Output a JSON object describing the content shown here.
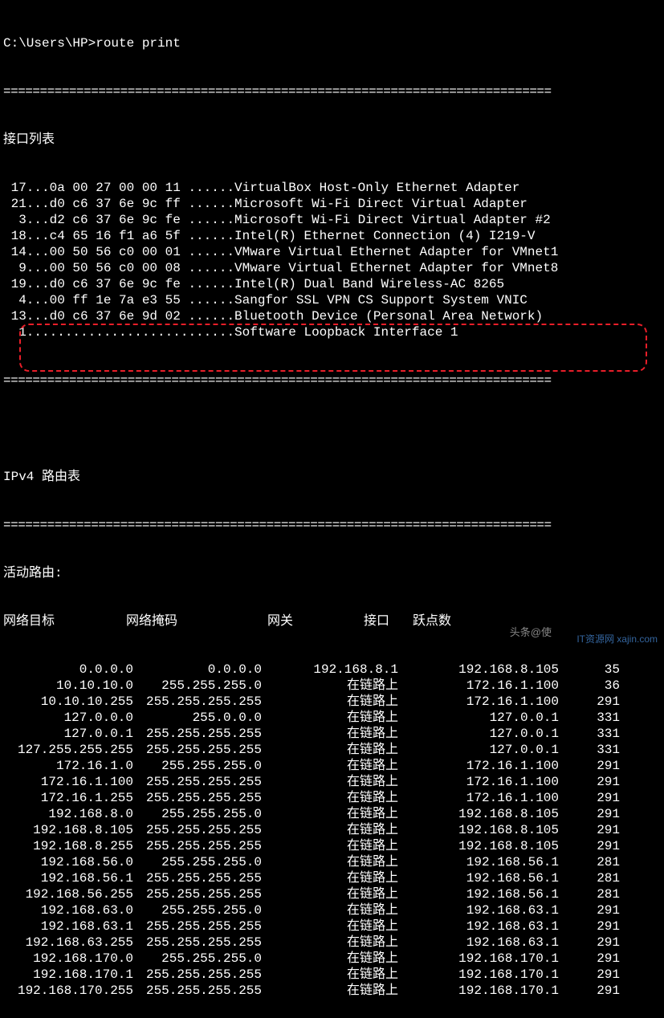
{
  "prompt": "C:\\Users\\HP>route print",
  "separator": "===========================================================================",
  "interfaces_header": "接口列表",
  "interfaces": [
    " 17...0a 00 27 00 00 11 ......VirtualBox Host-Only Ethernet Adapter",
    " 21...d0 c6 37 6e 9c ff ......Microsoft Wi-Fi Direct Virtual Adapter",
    "  3...d2 c6 37 6e 9c fe ......Microsoft Wi-Fi Direct Virtual Adapter #2",
    " 18...c4 65 16 f1 a6 5f ......Intel(R) Ethernet Connection (4) I219-V",
    " 14...00 50 56 c0 00 01 ......VMware Virtual Ethernet Adapter for VMnet1",
    "  9...00 50 56 c0 00 08 ......VMware Virtual Ethernet Adapter for VMnet8",
    " 19...d0 c6 37 6e 9c fe ......Intel(R) Dual Band Wireless-AC 8265",
    "  4...00 ff 1e 7a e3 55 ......Sangfor SSL VPN CS Support System VNIC",
    " 13...d0 c6 37 6e 9d 02 ......Bluetooth Device (Personal Area Network)",
    "  1...........................Software Loopback Interface 1"
  ],
  "ipv4_header": "IPv4 路由表",
  "active_routes_label": "活动路由:",
  "columns": {
    "dest": "网络目标",
    "mask": "网络掩码",
    "gw": "网关",
    "iface": "接口",
    "metric": "跃点数"
  },
  "routes": [
    {
      "dest": "0.0.0.0",
      "mask": "0.0.0.0",
      "gw": "192.168.8.1",
      "iface": "192.168.8.105",
      "metric": "35"
    },
    {
      "dest": "10.10.10.0",
      "mask": "255.255.255.0",
      "gw": "在链路上",
      "iface": "172.16.1.100",
      "metric": "36"
    },
    {
      "dest": "10.10.10.255",
      "mask": "255.255.255.255",
      "gw": "在链路上",
      "iface": "172.16.1.100",
      "metric": "291"
    },
    {
      "dest": "127.0.0.0",
      "mask": "255.0.0.0",
      "gw": "在链路上",
      "iface": "127.0.0.1",
      "metric": "331"
    },
    {
      "dest": "127.0.0.1",
      "mask": "255.255.255.255",
      "gw": "在链路上",
      "iface": "127.0.0.1",
      "metric": "331"
    },
    {
      "dest": "127.255.255.255",
      "mask": "255.255.255.255",
      "gw": "在链路上",
      "iface": "127.0.0.1",
      "metric": "331"
    },
    {
      "dest": "172.16.1.0",
      "mask": "255.255.255.0",
      "gw": "在链路上",
      "iface": "172.16.1.100",
      "metric": "291"
    },
    {
      "dest": "172.16.1.100",
      "mask": "255.255.255.255",
      "gw": "在链路上",
      "iface": "172.16.1.100",
      "metric": "291"
    },
    {
      "dest": "172.16.1.255",
      "mask": "255.255.255.255",
      "gw": "在链路上",
      "iface": "172.16.1.100",
      "metric": "291"
    },
    {
      "dest": "192.168.8.0",
      "mask": "255.255.255.0",
      "gw": "在链路上",
      "iface": "192.168.8.105",
      "metric": "291"
    },
    {
      "dest": "192.168.8.105",
      "mask": "255.255.255.255",
      "gw": "在链路上",
      "iface": "192.168.8.105",
      "metric": "291"
    },
    {
      "dest": "192.168.8.255",
      "mask": "255.255.255.255",
      "gw": "在链路上",
      "iface": "192.168.8.105",
      "metric": "291"
    },
    {
      "dest": "192.168.56.0",
      "mask": "255.255.255.0",
      "gw": "在链路上",
      "iface": "192.168.56.1",
      "metric": "281"
    },
    {
      "dest": "192.168.56.1",
      "mask": "255.255.255.255",
      "gw": "在链路上",
      "iface": "192.168.56.1",
      "metric": "281"
    },
    {
      "dest": "192.168.56.255",
      "mask": "255.255.255.255",
      "gw": "在链路上",
      "iface": "192.168.56.1",
      "metric": "281"
    },
    {
      "dest": "192.168.63.0",
      "mask": "255.255.255.0",
      "gw": "在链路上",
      "iface": "192.168.63.1",
      "metric": "291"
    },
    {
      "dest": "192.168.63.1",
      "mask": "255.255.255.255",
      "gw": "在链路上",
      "iface": "192.168.63.1",
      "metric": "291"
    },
    {
      "dest": "192.168.63.255",
      "mask": "255.255.255.255",
      "gw": "在链路上",
      "iface": "192.168.63.1",
      "metric": "291"
    },
    {
      "dest": "192.168.170.0",
      "mask": "255.255.255.0",
      "gw": "在链路上",
      "iface": "192.168.170.1",
      "metric": "291"
    },
    {
      "dest": "192.168.170.1",
      "mask": "255.255.255.255",
      "gw": "在链路上",
      "iface": "192.168.170.1",
      "metric": "291"
    },
    {
      "dest": "192.168.170.255",
      "mask": "255.255.255.255",
      "gw": "在链路上",
      "iface": "192.168.170.1",
      "metric": "291"
    }
  ],
  "watermark1": "头条@使",
  "watermark2": "IT资源网\nxajin.com"
}
